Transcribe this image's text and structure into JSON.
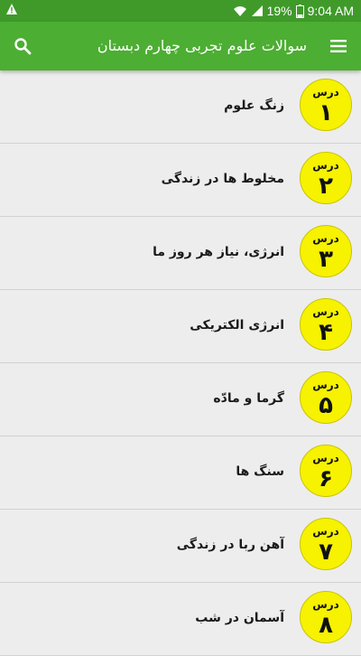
{
  "status_bar": {
    "battery": "19%",
    "time": "9:04 AM",
    "icons": [
      "warning-icon",
      "wifi-icon",
      "signal-icon",
      "battery-icon"
    ]
  },
  "app_bar": {
    "title": "سوالات علوم تجربی چهارم دبستان",
    "icons": [
      "search-icon",
      "menu-icon"
    ]
  },
  "colors": {
    "status_bar": "#3f9a2a",
    "app_bar": "#4cae32",
    "badge": "#f6f200",
    "background": "#ededed"
  },
  "lessons": [
    {
      "label": "درس",
      "number": "۱",
      "title": "زنگ علوم"
    },
    {
      "label": "درس",
      "number": "۲",
      "title": "مخلوط ها در زندگی"
    },
    {
      "label": "درس",
      "number": "۳",
      "title": "انرژی، نیاز هر روز ما"
    },
    {
      "label": "درس",
      "number": "۴",
      "title": "انرژی الکتریکی"
    },
    {
      "label": "درس",
      "number": "۵",
      "title": "گرما و مادّه"
    },
    {
      "label": "درس",
      "number": "۶",
      "title": "سنگ ها"
    },
    {
      "label": "درس",
      "number": "۷",
      "title": "آهن ربا در زندگی"
    },
    {
      "label": "درس",
      "number": "۸",
      "title": "آسمان در شب"
    }
  ]
}
